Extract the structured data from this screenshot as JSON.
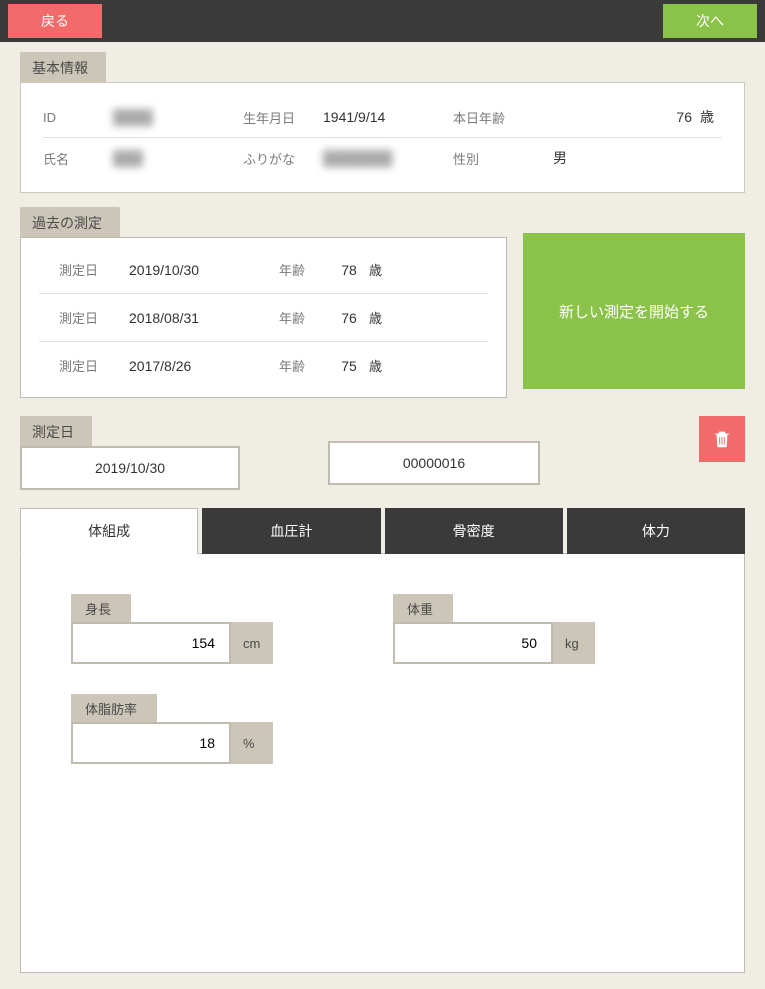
{
  "header": {
    "back": "戻る",
    "next": "次へ"
  },
  "basic_info": {
    "title": "基本情報",
    "id_label": "ID",
    "id_value": "████",
    "dob_label": "生年月日",
    "dob_value": "1941/9/14",
    "today_age_label": "本日年齢",
    "today_age_value": "76",
    "age_unit": "歳",
    "name_label": "氏名",
    "name_value": "███",
    "furigana_label": "ふりがな",
    "furigana_value": "███████",
    "sex_label": "性別",
    "sex_value": "男"
  },
  "past": {
    "title": "過去の測定",
    "date_label": "測定日",
    "age_label": "年齢",
    "age_unit": "歳",
    "rows": [
      {
        "date": "2019/10/30",
        "age": "78"
      },
      {
        "date": "2018/08/31",
        "age": "76"
      },
      {
        "date": "2017/8/26",
        "age": "75"
      }
    ],
    "start_label": "新しい測定を開始する"
  },
  "measure": {
    "date_title": "測定日",
    "date_value": "2019/10/30",
    "record_id": "00000016"
  },
  "tabs": {
    "t0": "体組成",
    "t1": "血圧計",
    "t2": "骨密度",
    "t3": "体力"
  },
  "body_comp": {
    "height_label": "身長",
    "height_value": "154",
    "height_unit": "cm",
    "weight_label": "体重",
    "weight_value": "50",
    "weight_unit": "kg",
    "fat_label": "体脂肪率",
    "fat_value": "18",
    "fat_unit": "%"
  }
}
